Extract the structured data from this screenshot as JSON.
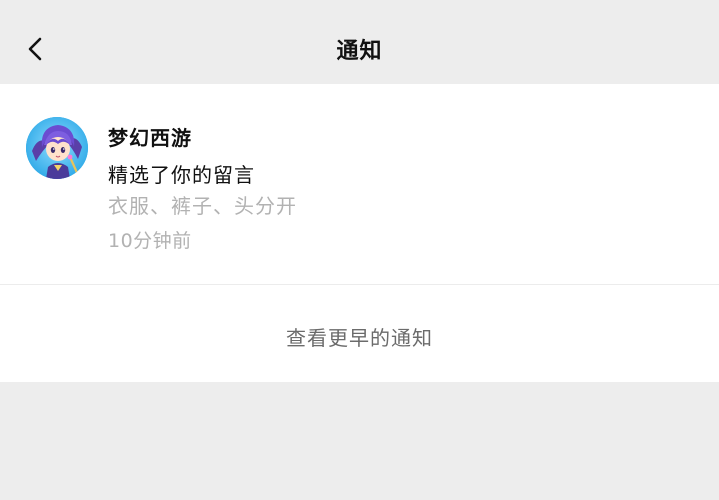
{
  "header": {
    "title": "通知",
    "back_icon": "chevron-left-icon"
  },
  "notification": {
    "sender": "梦幻西游",
    "action": "精选了你的留言",
    "quote": "衣服、裤子、头分开",
    "time": "10分钟前",
    "avatar": "game-character-avatar"
  },
  "footer": {
    "more_label": "查看更早的通知"
  },
  "colors": {
    "background": "#ededed",
    "card": "#ffffff",
    "primary_text": "#111111",
    "secondary_text": "#b2b2b2",
    "link_text": "#6b6b6b"
  }
}
